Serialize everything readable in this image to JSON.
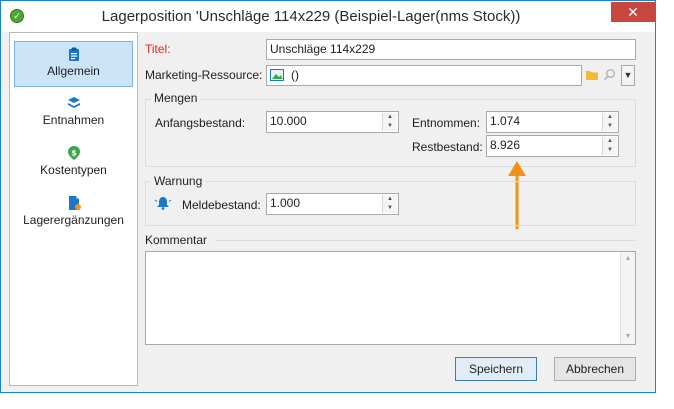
{
  "window": {
    "title": "Lagerposition 'Unschläge 114x229 (Beispiel-Lager(nms Stock))",
    "close_glyph": "✕"
  },
  "sidebar": {
    "items": [
      {
        "label": "Allgemein",
        "icon": "clipboard-icon",
        "active": true
      },
      {
        "label": "Entnahmen",
        "icon": "stack-icon",
        "active": false
      },
      {
        "label": "Kostentypen",
        "icon": "dollar-icon",
        "active": false
      },
      {
        "label": "Lagerergänzungen",
        "icon": "document-icon",
        "active": false
      }
    ]
  },
  "form": {
    "title_label": "Titel:",
    "title_value": "Unschläge 114x229",
    "marketing_label": "Marketing-Ressource:",
    "marketing_value": "()",
    "mengen": {
      "legend": "Mengen",
      "anfangsbestand_label": "Anfangsbestand:",
      "anfangsbestand_value": "10.000",
      "entnommen_label": "Entnommen:",
      "entnommen_value": "1.074",
      "restbestand_label": "Restbestand:",
      "restbestand_value": "8.926"
    },
    "warnung": {
      "legend": "Warnung",
      "meldebestand_label": "Meldebestand:",
      "meldebestand_value": "1.000"
    },
    "kommentar_label": "Kommentar",
    "kommentar_value": ""
  },
  "buttons": {
    "save": "Speichern",
    "cancel": "Abbrechen"
  },
  "colors": {
    "accent": "#1883d7",
    "title_label": "#e3261f",
    "arrow": "#f29318",
    "selection": "#cce4f7"
  }
}
